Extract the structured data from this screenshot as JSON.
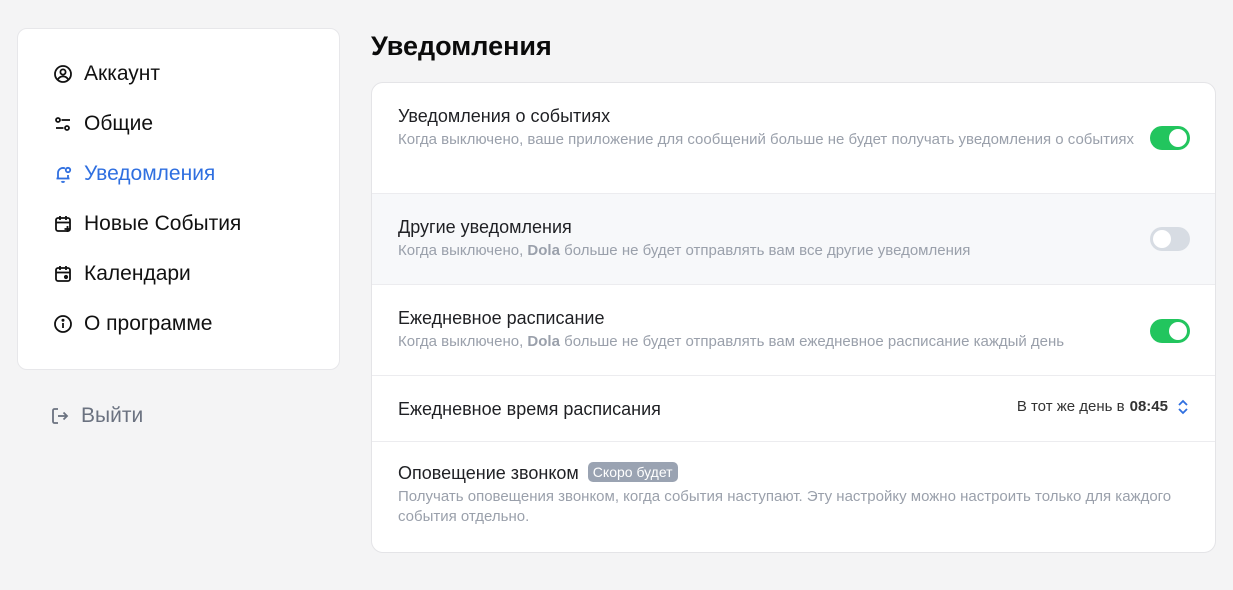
{
  "sidebar": {
    "items": [
      {
        "label": "Аккаунт",
        "icon": "user-circle-icon"
      },
      {
        "label": "Общие",
        "icon": "sliders-icon"
      },
      {
        "label": "Уведомления",
        "icon": "bell-icon",
        "active": true
      },
      {
        "label": "Новые События",
        "icon": "calendar-plus-icon"
      },
      {
        "label": "Календари",
        "icon": "calendar-icon"
      },
      {
        "label": "О программе",
        "icon": "info-icon"
      }
    ],
    "logout_label": "Выйти"
  },
  "page": {
    "title": "Уведомления"
  },
  "settings": {
    "event_notifications": {
      "title": "Уведомления о событиях",
      "desc": "Когда выключено, ваше приложение для сообщений больше не будет получать уведомления о событиях",
      "enabled": true
    },
    "other_notifications": {
      "title": "Другие уведомления",
      "desc_before": "Когда выключено, ",
      "desc_brand": "Dola",
      "desc_after": " больше не будет отправлять вам все другие уведомления",
      "enabled": false
    },
    "daily_schedule": {
      "title": "Ежедневное расписание",
      "desc_before": "Когда выключено, ",
      "desc_brand": "Dola",
      "desc_after": " больше не будет отправлять вам ежедневное расписание каждый день",
      "enabled": true
    },
    "daily_schedule_time": {
      "title": "Ежедневное время расписания",
      "value_prefix": "В тот же день в ",
      "value_time": "08:45"
    },
    "call_alert": {
      "title": "Оповещение звонком",
      "badge": "Скоро будет",
      "desc": "Получать оповещения звонком, когда события наступают. Эту настройку можно настроить только для каждого события отдельно."
    }
  },
  "colors": {
    "accent": "#2f6fe0",
    "toggle_on": "#22c55e",
    "toggle_off": "#d7dce3",
    "badge": "#9aa3b2"
  }
}
